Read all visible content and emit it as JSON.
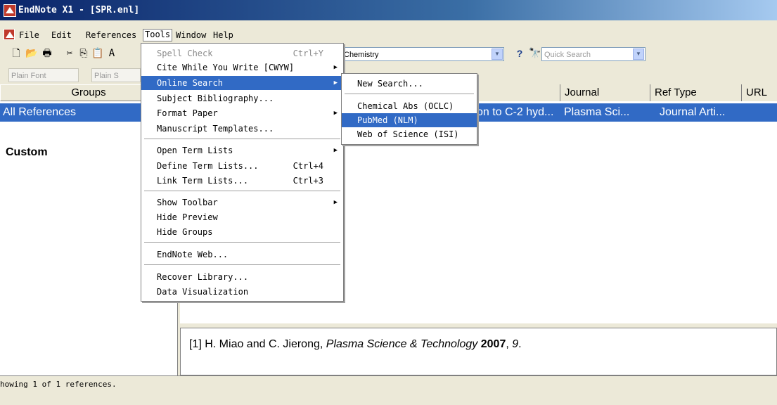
{
  "title_bar": {
    "title": "EndNote X1 - [SPR.enl]",
    "icon": "endnote-icon"
  },
  "menubar": {
    "items": [
      "File",
      "Edit",
      "References",
      "Tools",
      "Window",
      "Help"
    ],
    "active": "Tools"
  },
  "toolbar": {
    "style_combo": "Chemistry",
    "quick_search_placeholder": "Quick Search",
    "font_combo": "Plain Font",
    "size_combo": "Plain S",
    "help_icon": "?",
    "icons": [
      "new-icon",
      "open-icon",
      "print-icon",
      "cut-icon",
      "copy-icon",
      "paste-icon",
      "format-icon",
      "binoculars-icon"
    ]
  },
  "groups": {
    "header": "Groups",
    "all_references": "All References",
    "custom": "Custom"
  },
  "references_table": {
    "columns": [
      "Journal",
      "Ref Type",
      "URL"
    ],
    "rows": [
      {
        "title_fragment": "on to C-2 hyd...",
        "journal": "Plasma Sci...",
        "ref_type": "Journal Arti..."
      }
    ]
  },
  "preview": {
    "prefix": "[1] H. Miao and C. Jierong, ",
    "journal": "Plasma Science & Technology",
    "year": "2007",
    "sep": ", ",
    "volume": "9",
    "suffix": "."
  },
  "status": {
    "text": "howing  1  of 1 references."
  },
  "tools_menu": {
    "items": [
      {
        "label": "Spell Check",
        "shortcut": "Ctrl+Y",
        "disabled": true
      },
      {
        "label": "Cite While You Write [CWYW]",
        "submenu": true
      },
      {
        "label": "Online Search",
        "submenu": true,
        "highlighted": true
      },
      {
        "label": "Subject Bibliography..."
      },
      {
        "label": "Format Paper",
        "submenu": true
      },
      {
        "label": "Manuscript Templates..."
      },
      {
        "label": "Open Term Lists",
        "submenu": true
      },
      {
        "label": "Define Term Lists...",
        "shortcut": "Ctrl+4"
      },
      {
        "label": "Link Term Lists...",
        "shortcut": "Ctrl+3"
      },
      {
        "label": "Show Toolbar",
        "submenu": true
      },
      {
        "label": "Hide Preview"
      },
      {
        "label": "Hide Groups"
      },
      {
        "label": "EndNote Web..."
      },
      {
        "label": "Recover Library..."
      },
      {
        "label": "Data Visualization"
      }
    ]
  },
  "online_search_menu": {
    "items": [
      {
        "label": "New Search..."
      },
      {
        "label": "Chemical Abs (OCLC)"
      },
      {
        "label": "PubMed (NLM)",
        "highlighted": true
      },
      {
        "label": "Web of Science (ISI)"
      }
    ]
  },
  "colors": {
    "selection": "#316ac5",
    "title_start": "#0a246a",
    "title_end": "#a6caf0",
    "chrome": "#ece9d8"
  }
}
